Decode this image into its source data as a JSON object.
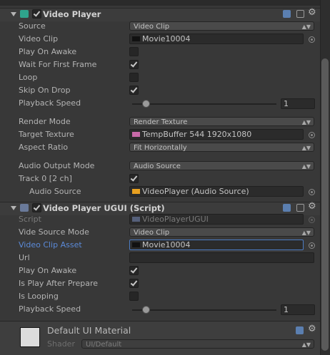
{
  "video_player": {
    "title": "Video Player",
    "enabled": true,
    "fields": {
      "source": {
        "label": "Source",
        "value": "Video Clip"
      },
      "video_clip": {
        "label": "Video Clip",
        "value": "Movie10004"
      },
      "play_on_awake": {
        "label": "Play On Awake",
        "checked": false
      },
      "wait_first_frame": {
        "label": "Wait For First Frame",
        "checked": true
      },
      "loop": {
        "label": "Loop",
        "checked": false
      },
      "skip_on_drop": {
        "label": "Skip On Drop",
        "checked": true
      },
      "playback_speed": {
        "label": "Playback Speed",
        "value": "1"
      },
      "render_mode": {
        "label": "Render Mode",
        "value": "Render Texture"
      },
      "target_texture": {
        "label": "Target Texture",
        "value": "TempBuffer 544 1920x1080"
      },
      "aspect_ratio": {
        "label": "Aspect Ratio",
        "value": "Fit Horizontally"
      },
      "audio_output_mode": {
        "label": "Audio Output Mode",
        "value": "Audio Source"
      },
      "track0": {
        "label": "Track 0 [2 ch]",
        "checked": true
      },
      "audio_source": {
        "label": "Audio Source",
        "value": "VideoPlayer (Audio Source)"
      }
    }
  },
  "ugui": {
    "title": "Video Player UGUI (Script)",
    "enabled": true,
    "fields": {
      "script": {
        "label": "Script",
        "value": "VideoPlayerUGUI"
      },
      "vide_source_mode": {
        "label": "Vide Source Mode",
        "value": "Video Clip"
      },
      "video_clip_asset": {
        "label": "Video Clip Asset",
        "value": "Movie10004"
      },
      "url": {
        "label": "Url",
        "value": ""
      },
      "play_on_awake": {
        "label": "Play On Awake",
        "checked": true
      },
      "play_after_prepare": {
        "label": "Is Play After Prepare",
        "checked": true
      },
      "is_looping": {
        "label": "Is Looping",
        "checked": false
      },
      "playback_speed": {
        "label": "Playback Speed",
        "value": "1"
      }
    }
  },
  "material": {
    "name": "Default UI Material",
    "shader_label": "Shader",
    "shader_value": "UI/Default"
  },
  "colors": {
    "background": "#383838",
    "highlight_label": "#5b8ad8",
    "selection_border": "#4c7cc4"
  },
  "icons": [
    "foldout-arrow-icon",
    "video-player-component-icon",
    "script-component-icon",
    "help-book-icon",
    "preset-sliders-icon",
    "gear-icon",
    "object-picker-icon",
    "texture-icon",
    "audio-source-icon",
    "movie-clip-icon"
  ]
}
